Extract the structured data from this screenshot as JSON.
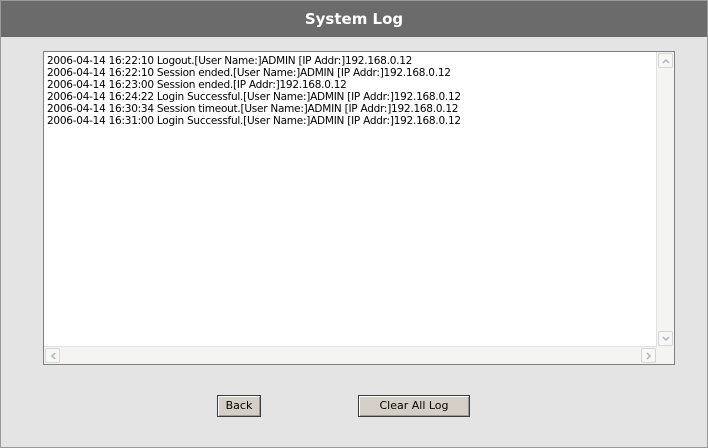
{
  "window": {
    "title": "System Log"
  },
  "log": {
    "lines": [
      "2006-04-14 16:22:10 Logout.[User Name:]ADMIN [IP Addr:]192.168.0.12",
      "2006-04-14 16:22:10 Session ended.[User Name:]ADMIN [IP Addr:]192.168.0.12",
      "2006-04-14 16:23:00 Session ended.[IP Addr:]192.168.0.12",
      "2006-04-14 16:24:22 Login Successful.[User Name:]ADMIN [IP Addr:]192.168.0.12",
      "2006-04-14 16:30:34 Session timeout.[User Name:]ADMIN [IP Addr:]192.168.0.12",
      "2006-04-14 16:31:00 Login Successful.[User Name:]ADMIN [IP Addr:]192.168.0.12"
    ]
  },
  "buttons": {
    "back_label": "Back",
    "clear_label": "Clear All Log"
  },
  "icons": {
    "scroll_up": "chevron-up-icon",
    "scroll_down": "chevron-down-icon",
    "scroll_left": "chevron-left-icon",
    "scroll_right": "chevron-right-icon"
  },
  "colors": {
    "title_bar": "#6b6b6b",
    "page_background": "#e4e4e4",
    "button_face": "#d4d0c8"
  }
}
